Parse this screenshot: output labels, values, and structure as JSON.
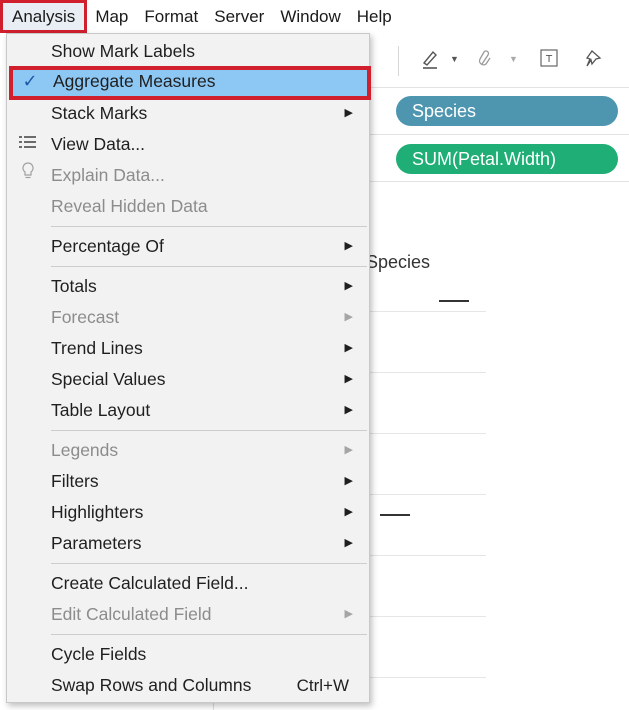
{
  "menubar": {
    "items": [
      "Analysis",
      "Map",
      "Format",
      "Server",
      "Window",
      "Help"
    ]
  },
  "shelves": {
    "columns_pill": "Species",
    "rows_pill": "SUM(Petal.Width)"
  },
  "view": {
    "title_fragment": "Species"
  },
  "menu": {
    "show_mark_labels": "Show Mark Labels",
    "aggregate_measures": "Aggregate Measures",
    "stack_marks": "Stack Marks",
    "view_data": "View Data...",
    "explain_data": "Explain Data...",
    "reveal_hidden_data": "Reveal Hidden Data",
    "percentage_of": "Percentage Of",
    "totals": "Totals",
    "forecast": "Forecast",
    "trend_lines": "Trend Lines",
    "special_values": "Special Values",
    "table_layout": "Table Layout",
    "legends": "Legends",
    "filters": "Filters",
    "highlighters": "Highlighters",
    "parameters": "Parameters",
    "create_calculated_field": "Create Calculated Field...",
    "edit_calculated_field": "Edit Calculated Field",
    "cycle_fields": "Cycle Fields",
    "swap_rows_columns": "Swap Rows and Columns",
    "swap_shortcut": "Ctrl+W"
  },
  "colors": {
    "highlight_border": "#d0202e",
    "highlight_bg": "#8dc7f4",
    "dimension_pill": "#4e96b0",
    "measure_pill": "#1fae75"
  }
}
